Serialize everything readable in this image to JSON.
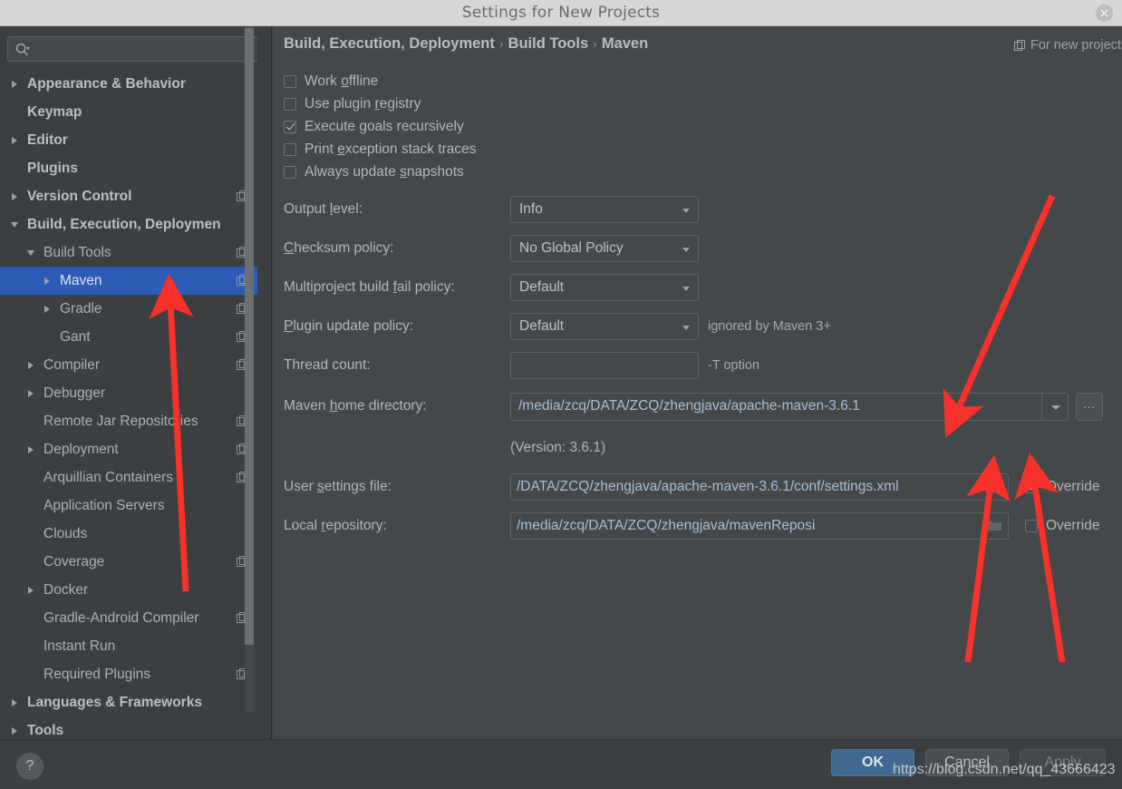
{
  "window": {
    "title": "Settings for New Projects",
    "close_label": "✕"
  },
  "sidebar": {
    "search": {
      "placeholder": "",
      "value": "",
      "icon": "search-icon"
    },
    "items": [
      {
        "label": "Appearance & Behavior",
        "indent": 0,
        "twisty": "right",
        "bold": true,
        "copy": false,
        "selected": false
      },
      {
        "label": "Keymap",
        "indent": 0,
        "twisty": "none",
        "bold": true,
        "copy": false,
        "selected": false
      },
      {
        "label": "Editor",
        "indent": 0,
        "twisty": "right",
        "bold": true,
        "copy": false,
        "selected": false
      },
      {
        "label": "Plugins",
        "indent": 0,
        "twisty": "none",
        "bold": true,
        "copy": false,
        "selected": false
      },
      {
        "label": "Version Control",
        "indent": 0,
        "twisty": "right",
        "bold": true,
        "copy": true,
        "selected": false
      },
      {
        "label": "Build, Execution, Deploymen",
        "indent": 0,
        "twisty": "down",
        "bold": true,
        "copy": false,
        "selected": false
      },
      {
        "label": "Build Tools",
        "indent": 1,
        "twisty": "down",
        "bold": false,
        "copy": true,
        "selected": false
      },
      {
        "label": "Maven",
        "indent": 2,
        "twisty": "right",
        "bold": false,
        "copy": true,
        "selected": true
      },
      {
        "label": "Gradle",
        "indent": 2,
        "twisty": "right",
        "bold": false,
        "copy": true,
        "selected": false
      },
      {
        "label": "Gant",
        "indent": 2,
        "twisty": "none",
        "bold": false,
        "copy": true,
        "selected": false
      },
      {
        "label": "Compiler",
        "indent": 1,
        "twisty": "right",
        "bold": false,
        "copy": true,
        "selected": false
      },
      {
        "label": "Debugger",
        "indent": 1,
        "twisty": "right",
        "bold": false,
        "copy": false,
        "selected": false
      },
      {
        "label": "Remote Jar Repositories",
        "indent": 1,
        "twisty": "none",
        "bold": false,
        "copy": true,
        "selected": false
      },
      {
        "label": "Deployment",
        "indent": 1,
        "twisty": "right",
        "bold": false,
        "copy": true,
        "selected": false
      },
      {
        "label": "Arquillian Containers",
        "indent": 1,
        "twisty": "none",
        "bold": false,
        "copy": true,
        "selected": false
      },
      {
        "label": "Application Servers",
        "indent": 1,
        "twisty": "none",
        "bold": false,
        "copy": false,
        "selected": false
      },
      {
        "label": "Clouds",
        "indent": 1,
        "twisty": "none",
        "bold": false,
        "copy": false,
        "selected": false
      },
      {
        "label": "Coverage",
        "indent": 1,
        "twisty": "none",
        "bold": false,
        "copy": true,
        "selected": false
      },
      {
        "label": "Docker",
        "indent": 1,
        "twisty": "right",
        "bold": false,
        "copy": false,
        "selected": false
      },
      {
        "label": "Gradle-Android Compiler",
        "indent": 1,
        "twisty": "none",
        "bold": false,
        "copy": true,
        "selected": false
      },
      {
        "label": "Instant Run",
        "indent": 1,
        "twisty": "none",
        "bold": false,
        "copy": false,
        "selected": false
      },
      {
        "label": "Required Plugins",
        "indent": 1,
        "twisty": "none",
        "bold": false,
        "copy": true,
        "selected": false
      },
      {
        "label": "Languages & Frameworks",
        "indent": 0,
        "twisty": "right",
        "bold": true,
        "copy": false,
        "selected": false
      },
      {
        "label": "Tools",
        "indent": 0,
        "twisty": "right",
        "bold": true,
        "copy": false,
        "selected": false
      }
    ]
  },
  "main": {
    "breadcrumb": {
      "part1": "Build, Execution, Deployment",
      "sep1": "›",
      "part2": "Build Tools",
      "sep2": "›",
      "part3": "Maven"
    },
    "for_new_projects": "For new projects",
    "checkboxes": [
      {
        "label_pre": "Work ",
        "label_mn": "o",
        "label_post": "ffline",
        "checked": false
      },
      {
        "label_pre": "Use plugin ",
        "label_mn": "r",
        "label_post": "egistry",
        "checked": false
      },
      {
        "label_pre": "Execute ",
        "label_mn": "g",
        "label_post": "oals recursively",
        "checked": true
      },
      {
        "label_pre": "Print ",
        "label_mn": "e",
        "label_post": "xception stack traces",
        "checked": false
      },
      {
        "label_pre": "Always update ",
        "label_mn": "s",
        "label_post": "napshots",
        "checked": false
      }
    ],
    "fields": {
      "output_level": {
        "label_pre": "Output ",
        "label_mn": "l",
        "label_post": "evel:",
        "value": "Info"
      },
      "checksum": {
        "label_pre": "",
        "label_mn": "C",
        "label_post": "hecksum policy:",
        "value": "No Global Policy"
      },
      "multiproject": {
        "label_pre": "Multiproject build ",
        "label_mn": "f",
        "label_post": "ail policy:",
        "value": "Default"
      },
      "plugin_update": {
        "label_pre": "",
        "label_mn": "P",
        "label_post": "lugin update policy:",
        "value": "Default",
        "hint": "ignored by Maven 3+"
      },
      "thread_count": {
        "label_pre": "Thread count:",
        "label_mn": "",
        "label_post": "",
        "value": "",
        "hint": "-T option"
      },
      "maven_home": {
        "label_pre": "Maven ",
        "label_mn": "h",
        "label_post": "ome directory:",
        "value": "/media/zcq/DATA/ZCQ/zhengjava/apache-maven-3.6.1",
        "ellipsis_label": "..."
      },
      "version_note": "(Version: 3.6.1)",
      "user_settings": {
        "label_pre": "User ",
        "label_mn": "s",
        "label_post": "ettings file:",
        "value": "/DATA/ZCQ/zhengjava/apache-maven-3.6.1/conf/settings.xml",
        "override_label": "Override",
        "override_checked": true
      },
      "local_repo": {
        "label_pre": "Local ",
        "label_mn": "r",
        "label_post": "epository:",
        "value": "/media/zcq/DATA/ZCQ/zhengjava/mavenReposi",
        "override_label": "Override",
        "override_checked": false
      }
    }
  },
  "footer": {
    "help_label": "?",
    "ok_label": "OK",
    "cancel_label": "Cancel",
    "apply_label": "Apply",
    "watermark": "https://blog.csdn.net/qq_43666423"
  },
  "colors": {
    "accent_selection": "#2d5bb5",
    "annotation_red": "#f8312a",
    "panel_bg": "#45484a",
    "sidebar_bg": "#3c3f41",
    "ok_button": "#41698f"
  }
}
